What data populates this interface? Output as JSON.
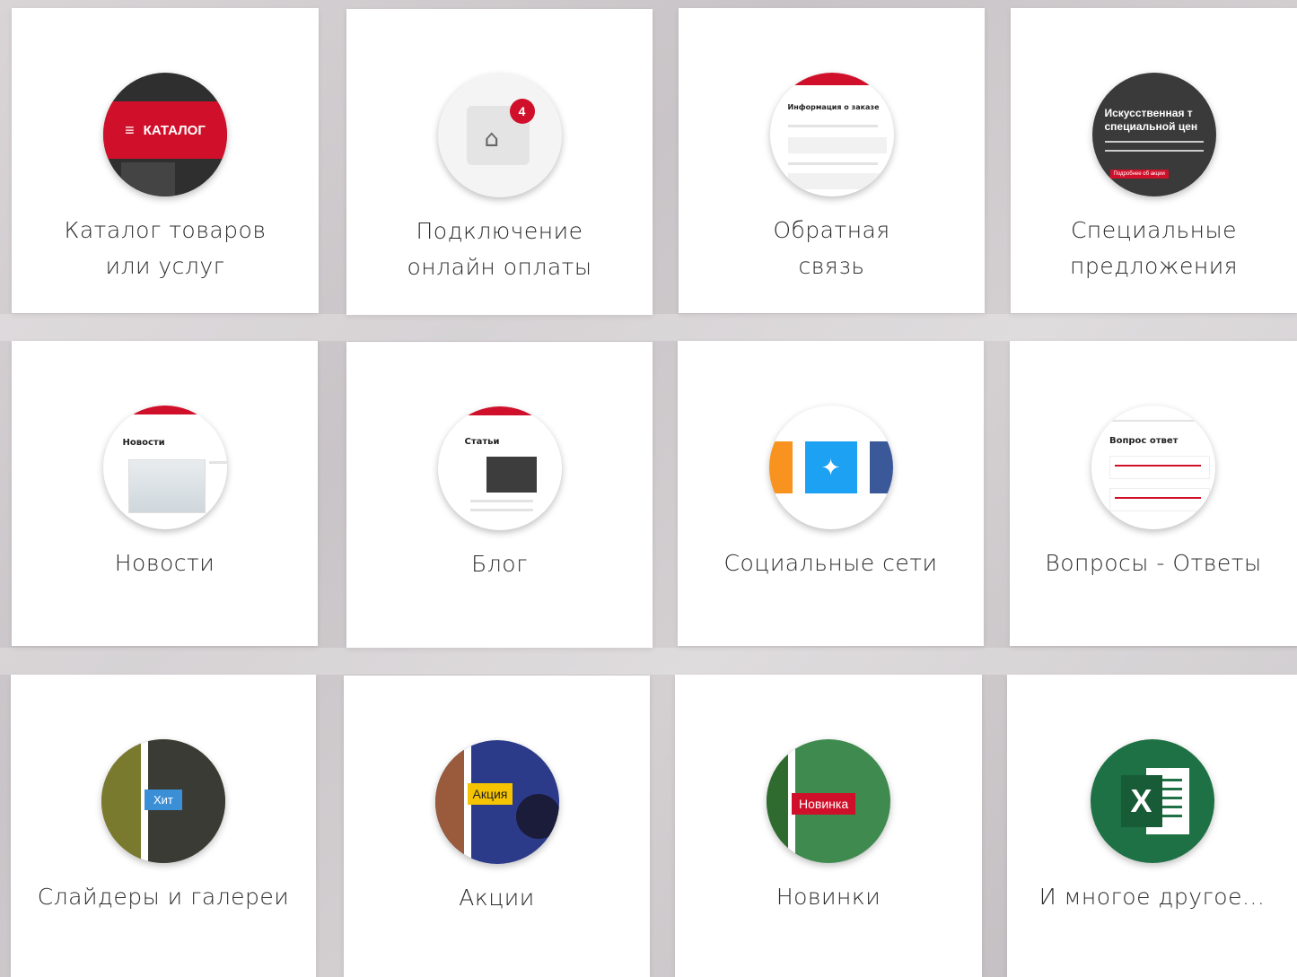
{
  "cards": [
    {
      "lines": [
        "Каталог товаров",
        "или услуг"
      ],
      "icon": "catalog-icon",
      "badge_text": "КАТАЛОГ"
    },
    {
      "lines": [
        "Подключение",
        "онлайн оплаты"
      ],
      "icon": "basket-icon",
      "badge": "4"
    },
    {
      "lines": [
        "Обратная",
        "связь"
      ],
      "icon": "feedback-form-icon",
      "mini_title": "Информация о заказе"
    },
    {
      "lines": [
        "Специальные",
        "предложения"
      ],
      "icon": "special-offer-icon",
      "headline": [
        "Искусственная т",
        "специальной цен"
      ],
      "button": "Подробнее об акции"
    },
    {
      "lines": [
        "Новости"
      ],
      "icon": "news-icon",
      "mini_title": "Новости"
    },
    {
      "lines": [
        "Блог"
      ],
      "icon": "blog-icon",
      "mini_title": "Статьи"
    },
    {
      "lines": [
        "Социальные сети"
      ],
      "icon": "social-networks-icon"
    },
    {
      "lines": [
        "Вопросы - Ответы"
      ],
      "icon": "faq-icon",
      "mini_title": "Вопрос ответ"
    },
    {
      "lines": [
        "Слайдеры и галереи"
      ],
      "icon": "sliders-icon",
      "tag": "Хит"
    },
    {
      "lines": [
        "Акции"
      ],
      "icon": "promotions-icon",
      "tag": "Акция"
    },
    {
      "lines": [
        "Новинки"
      ],
      "icon": "new-items-icon",
      "tag": "Новинка"
    },
    {
      "lines": [
        "И многое другое..."
      ],
      "icon": "excel-icon",
      "letter": "X"
    }
  ],
  "colors": {
    "accent": "#d0102a",
    "excel": "#1e7145",
    "twitter": "#1da1f2"
  }
}
